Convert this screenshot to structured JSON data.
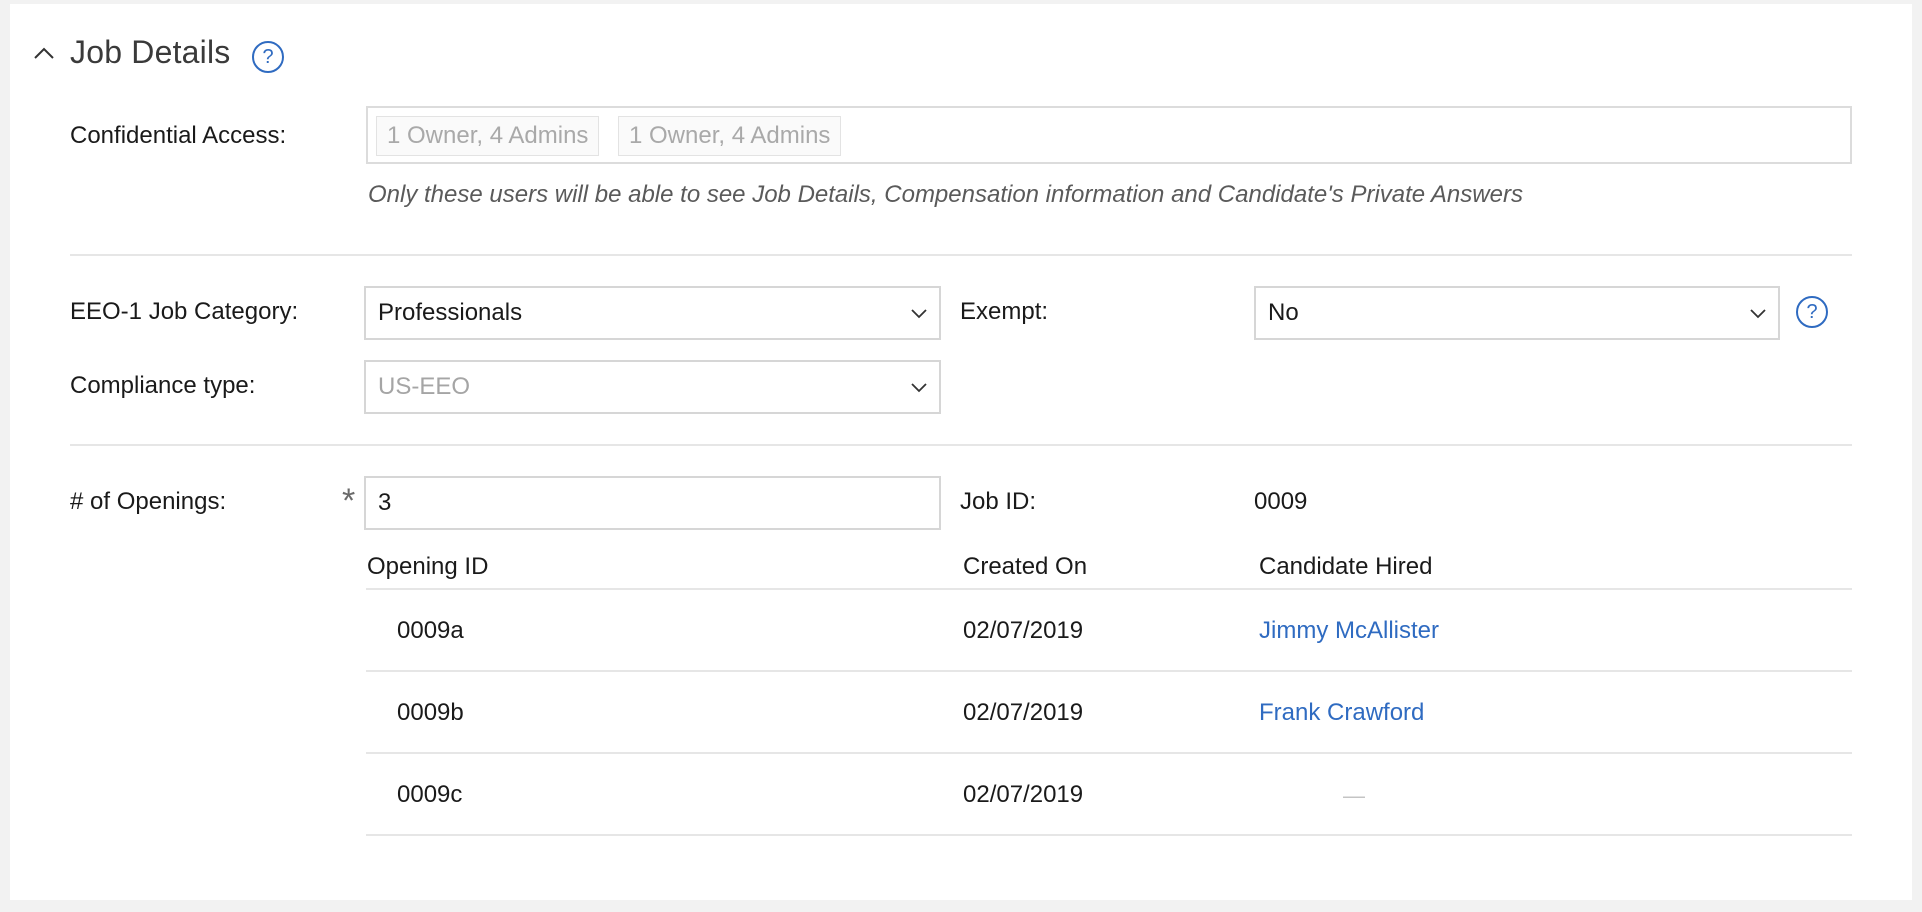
{
  "section": {
    "title": "Job Details"
  },
  "confidential": {
    "label": "Confidential Access:",
    "chips": [
      "1 Owner, 4 Admins",
      "1 Owner, 4 Admins"
    ],
    "hint": "Only these users will be able to see Job Details, Compensation information and Candidate's Private Answers"
  },
  "eeo": {
    "label": "EEO-1 Job Category:",
    "value": "Professionals"
  },
  "exempt": {
    "label": "Exempt:",
    "value": "No"
  },
  "compliance": {
    "label": "Compliance type:",
    "value": "US-EEO"
  },
  "openings": {
    "label": "# of Openings:",
    "required_mark": "*",
    "value": "3"
  },
  "job_id": {
    "label": "Job ID:",
    "value": "0009"
  },
  "table": {
    "headers": [
      "Opening ID",
      "Created On",
      "Candidate Hired"
    ],
    "rows": [
      {
        "opening_id": "0009a",
        "created_on": "02/07/2019",
        "candidate": "Jimmy McAllister"
      },
      {
        "opening_id": "0009b",
        "created_on": "02/07/2019",
        "candidate": "Frank Crawford"
      },
      {
        "opening_id": "0009c",
        "created_on": "02/07/2019",
        "candidate": "—"
      }
    ]
  },
  "icons": {
    "collapse": "chevron-up-icon",
    "help": "question-circle-icon",
    "dropdown": "chevron-down-icon"
  },
  "colors": {
    "accent": "#2f6bc1",
    "border": "#d6d6d6",
    "muted": "#a5a5a5"
  }
}
